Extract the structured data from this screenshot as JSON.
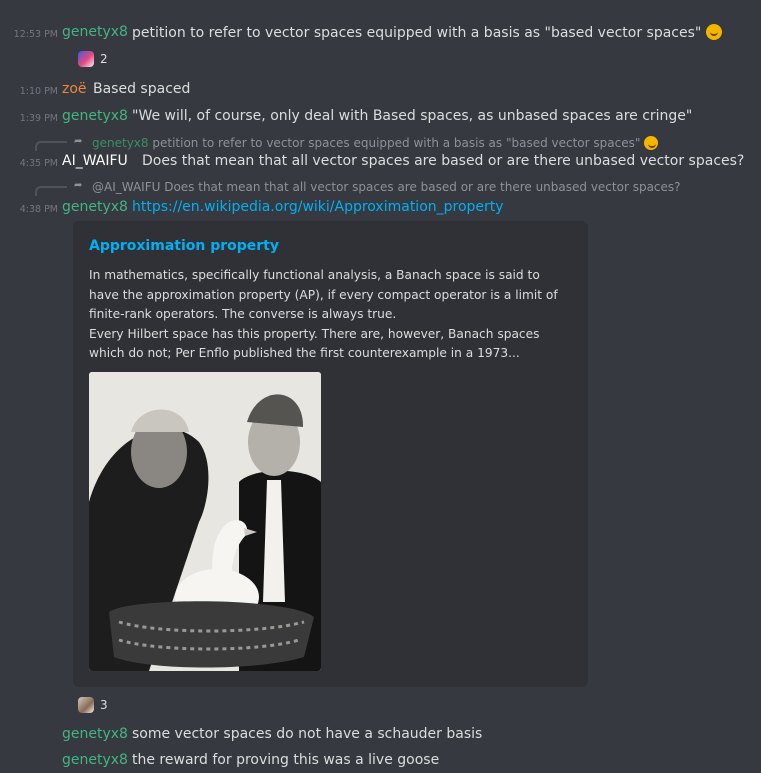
{
  "messages": [
    {
      "time": "12:53 PM",
      "author": "genetyx8",
      "text": "petition to refer to vector spaces equipped with a basis as \"based vector spaces\""
    },
    {
      "time": "1:10 PM",
      "author": "zoë",
      "text": "Based spaced"
    },
    {
      "time": "1:39 PM",
      "author": "genetyx8",
      "text": "\"We will, of course, only deal with Based spaces, as unbased spaces are cringe\""
    },
    {
      "time": "4:35 PM",
      "author": "AI_WAIFU",
      "text": "Does that mean that all vector spaces are based or are there unbased vector spaces?",
      "reply": {
        "author": "genetyx8",
        "text": "petition to refer to vector spaces equipped with a basis as \"based vector spaces\""
      }
    },
    {
      "time": "4:38 PM",
      "author": "genetyx8",
      "text": "https://en.wikipedia.org/wiki/Approximation_property",
      "reply": {
        "author": "@AI_WAIFU",
        "text": "Does that mean that all vector spaces are based or are there unbased vector spaces?"
      }
    },
    {
      "author": "genetyx8",
      "text": "some vector spaces do not have a schauder basis"
    },
    {
      "author": "genetyx8",
      "text": "the reward for proving this was a live goose"
    }
  ],
  "reactions": [
    {
      "icon": "anime-avatar-emoji",
      "count": "2"
    },
    {
      "icon": "goose-emoji",
      "count": "3"
    }
  ],
  "embed": {
    "title": "Approximation property",
    "description": "In mathematics, specifically functional analysis, a Banach space is said to have the approximation property (AP), if every compact operator is a limit of finite-rank operators. The converse is always true.\nEvery Hilbert space has this property. There are, however, Banach spaces which do not; Per Enflo published the first counterexample in a 1973...",
    "image": "photo of two men with a live goose in a basket"
  },
  "colors": {
    "background": "#36393f",
    "embed_bg": "#2f3136",
    "genetyx8": "#43b581",
    "zoe": "#f0873c",
    "link": "#00b0f4"
  }
}
